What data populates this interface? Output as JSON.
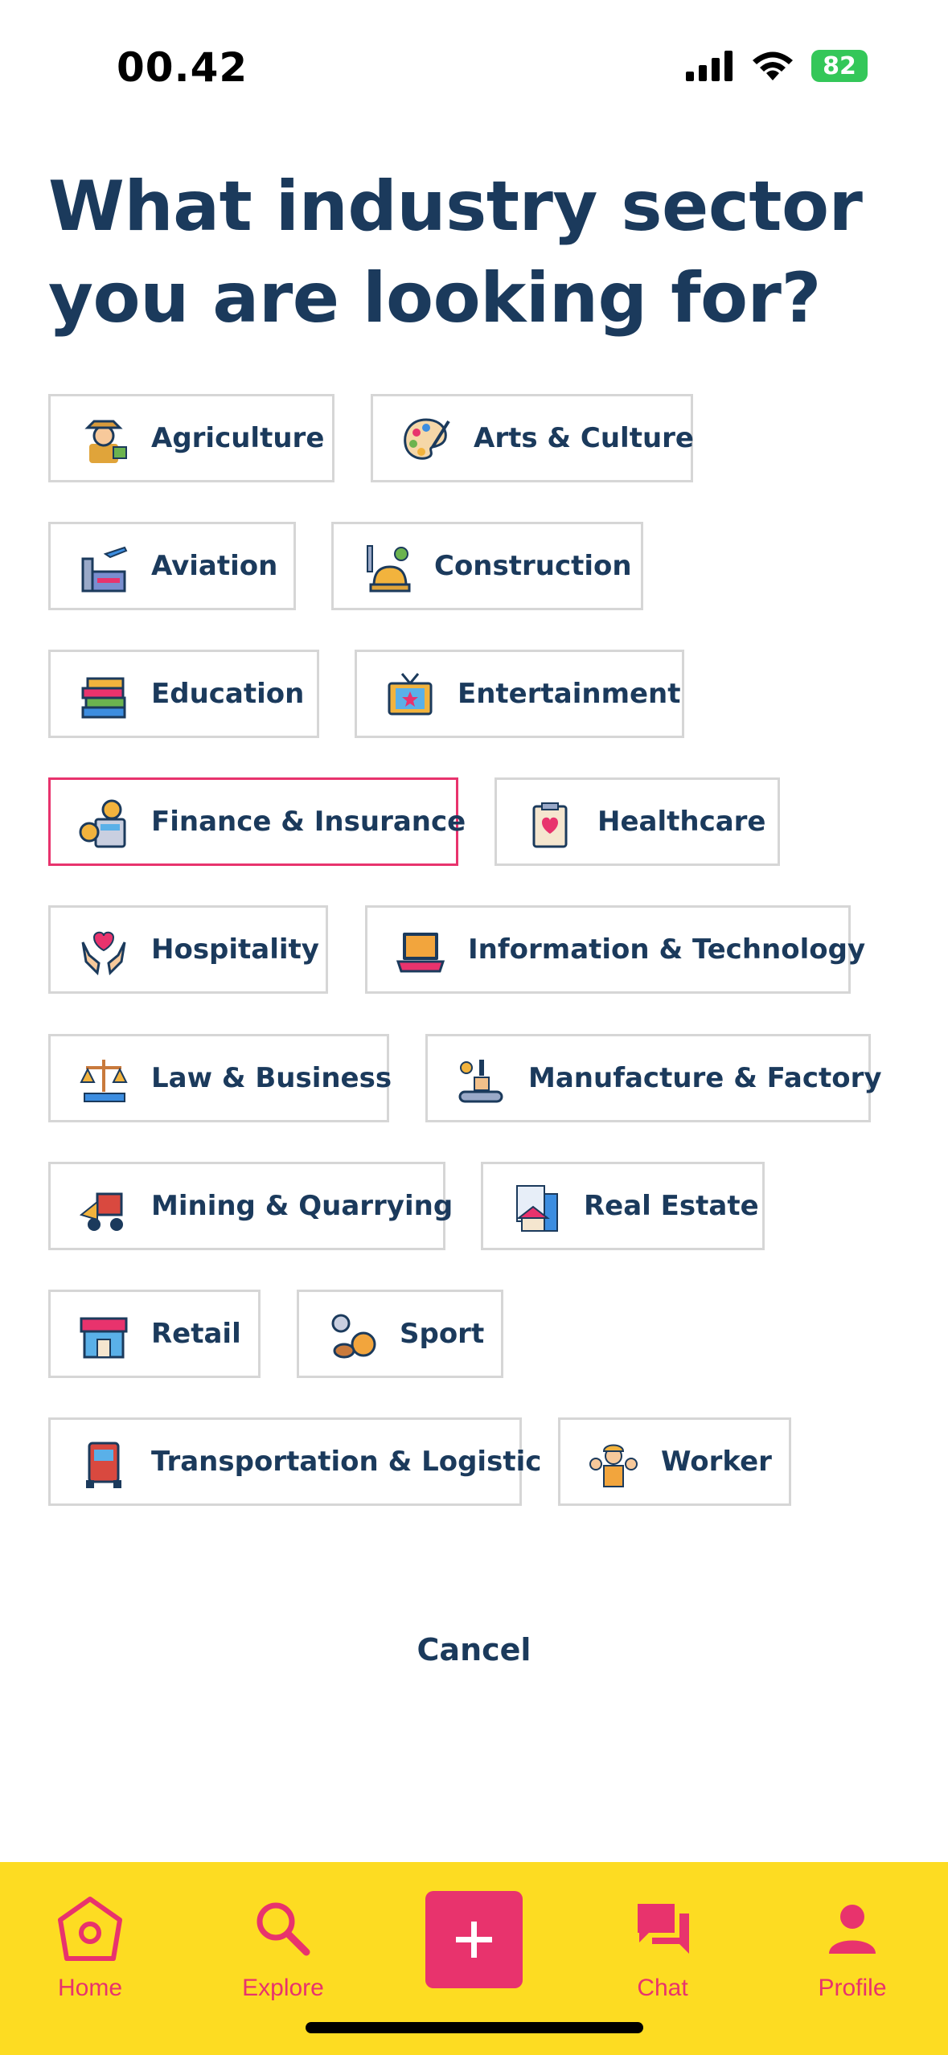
{
  "status": {
    "time": "00.42",
    "battery": "82"
  },
  "headline": "What industry sector you are looking for?",
  "sectors": [
    {
      "label": "Agriculture",
      "icon": "farmer-icon"
    },
    {
      "label": "Arts & Culture",
      "icon": "palette-icon"
    },
    {
      "label": "Aviation",
      "icon": "airport-icon"
    },
    {
      "label": "Construction",
      "icon": "hardhat-tools-icon"
    },
    {
      "label": "Education",
      "icon": "books-icon"
    },
    {
      "label": "Entertainment",
      "icon": "tv-icon"
    },
    {
      "label": "Finance & Insurance",
      "icon": "calculator-coins-icon",
      "selected": true
    },
    {
      "label": "Healthcare",
      "icon": "medical-clipboard-icon"
    },
    {
      "label": "Hospitality",
      "icon": "hands-heart-icon"
    },
    {
      "label": "Information & Technology",
      "icon": "laptop-icon"
    },
    {
      "label": "Law & Business",
      "icon": "scales-icon"
    },
    {
      "label": "Manufacture & Factory",
      "icon": "conveyor-icon"
    },
    {
      "label": "Mining & Quarrying",
      "icon": "mining-vehicle-icon"
    },
    {
      "label": "Real Estate",
      "icon": "house-document-icon"
    },
    {
      "label": "Retail",
      "icon": "store-icon"
    },
    {
      "label": "Sport",
      "icon": "sports-balls-icon"
    },
    {
      "label": "Transportation & Logistic",
      "icon": "truck-icon"
    },
    {
      "label": "Worker",
      "icon": "workers-icon"
    }
  ],
  "cancel_label": "Cancel",
  "nav": {
    "home": "Home",
    "explore": "Explore",
    "add": "+",
    "chat": "Chat",
    "profile": "Profile"
  },
  "colors": {
    "accent": "#e8336d",
    "nav_bg": "#fddc22",
    "text": "#1b3a5c",
    "chip_border": "#d6d6d6"
  }
}
